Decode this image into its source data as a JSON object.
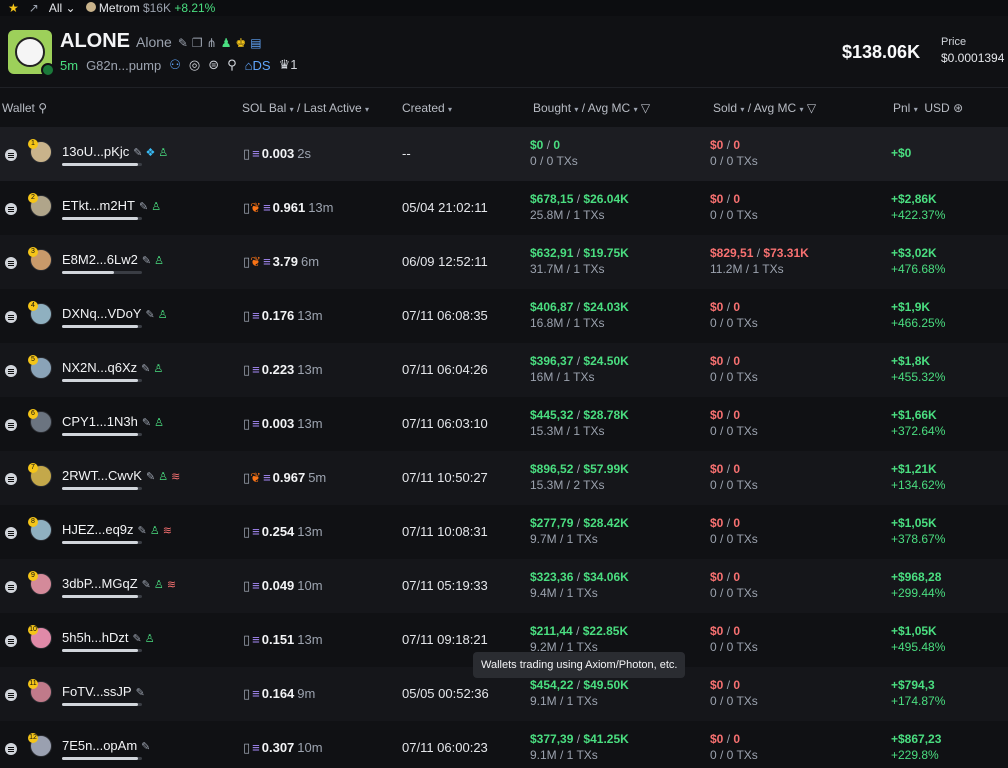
{
  "topbar": {
    "filter": "All",
    "token_name": "Metrom",
    "token_mcap": "$16K",
    "token_change": "+8.21%"
  },
  "token": {
    "name": "ALONE",
    "subname": "Alone",
    "age": "5m",
    "address": "G82n...pump",
    "ds_label": "DS",
    "holders_count": "1",
    "market_cap": "$138.06K",
    "price_label": "Price",
    "price": "$0.0001394"
  },
  "columns": {
    "wallet": "Wallet",
    "sol_bal": "SOL Bal",
    "last_active": "/ Last Active",
    "created": "Created",
    "bought": "Bought",
    "avg_mc_b": "/ Avg MC",
    "sold": "Sold",
    "avg_mc_s": "/ Avg MC",
    "pnl": "Pnl",
    "usd": "USD"
  },
  "tooltip": "Wallets trading using Axiom/Photon, etc.",
  "rows": [
    {
      "rank": "1",
      "wallet": "13oU...pKjc",
      "sol": "0.003",
      "age": "2s",
      "created": "--",
      "bought": "$0",
      "bought_mc": "0",
      "bought_sub": "0 / 0 TXs",
      "sold": "$0",
      "sold_mc": "0",
      "sold_sub": "0 / 0 TXs",
      "pnl": "+$0",
      "pct": "",
      "bar": 0.95
    },
    {
      "rank": "2",
      "wallet": "ETkt...m2HT",
      "sol": "0.961",
      "age": "13m",
      "created": "05/04 21:02:11",
      "bought": "$678,15",
      "bought_mc": "$26.04K",
      "bought_sub": "25.8M / 1 TXs",
      "sold": "$0",
      "sold_mc": "0",
      "sold_sub": "0 / 0 TXs",
      "pnl": "+$2,86K",
      "pct": "+422.37%",
      "bar": 0.95
    },
    {
      "rank": "3",
      "wallet": "E8M2...6Lw2",
      "sol": "3.79",
      "age": "6m",
      "created": "06/09 12:52:11",
      "bought": "$632,91",
      "bought_mc": "$19.75K",
      "bought_sub": "31.7M / 1 TXs",
      "sold": "$829,51",
      "sold_mc": "$73.31K",
      "sold_sub": "11.2M / 1 TXs",
      "pnl": "+$3,02K",
      "pct": "+476.68%",
      "bar": 0.65
    },
    {
      "rank": "4",
      "wallet": "DXNq...VDoY",
      "sol": "0.176",
      "age": "13m",
      "created": "07/11 06:08:35",
      "bought": "$406,87",
      "bought_mc": "$24.03K",
      "bought_sub": "16.8M / 1 TXs",
      "sold": "$0",
      "sold_mc": "0",
      "sold_sub": "0 / 0 TXs",
      "pnl": "+$1,9K",
      "pct": "+466.25%",
      "bar": 0.95
    },
    {
      "rank": "5",
      "wallet": "NX2N...q6Xz",
      "sol": "0.223",
      "age": "13m",
      "created": "07/11 06:04:26",
      "bought": "$396,37",
      "bought_mc": "$24.50K",
      "bought_sub": "16M / 1 TXs",
      "sold": "$0",
      "sold_mc": "0",
      "sold_sub": "0 / 0 TXs",
      "pnl": "+$1,8K",
      "pct": "+455.32%",
      "bar": 0.95
    },
    {
      "rank": "6",
      "wallet": "CPY1...1N3h",
      "sol": "0.003",
      "age": "13m",
      "created": "07/11 06:03:10",
      "bought": "$445,32",
      "bought_mc": "$28.78K",
      "bought_sub": "15.3M / 1 TXs",
      "sold": "$0",
      "sold_mc": "0",
      "sold_sub": "0 / 0 TXs",
      "pnl": "+$1,66K",
      "pct": "+372.64%",
      "bar": 0.95
    },
    {
      "rank": "7",
      "wallet": "2RWT...CwvK",
      "sol": "0.967",
      "age": "5m",
      "created": "07/11 10:50:27",
      "bought": "$896,52",
      "bought_mc": "$57.99K",
      "bought_sub": "15.3M / 2 TXs",
      "sold": "$0",
      "sold_mc": "0",
      "sold_sub": "0 / 0 TXs",
      "pnl": "+$1,21K",
      "pct": "+134.62%",
      "bar": 0.95
    },
    {
      "rank": "8",
      "wallet": "HJEZ...eq9z",
      "sol": "0.254",
      "age": "13m",
      "created": "07/11 10:08:31",
      "bought": "$277,79",
      "bought_mc": "$28.42K",
      "bought_sub": "9.7M / 1 TXs",
      "sold": "$0",
      "sold_mc": "0",
      "sold_sub": "0 / 0 TXs",
      "pnl": "+$1,05K",
      "pct": "+378.67%",
      "bar": 0.95
    },
    {
      "rank": "9",
      "wallet": "3dbP...MGqZ",
      "sol": "0.049",
      "age": "10m",
      "created": "07/11 05:19:33",
      "bought": "$323,36",
      "bought_mc": "$34.06K",
      "bought_sub": "9.4M / 1 TXs",
      "sold": "$0",
      "sold_mc": "0",
      "sold_sub": "0 / 0 TXs",
      "pnl": "+$968,28",
      "pct": "+299.44%",
      "bar": 0.95
    },
    {
      "rank": "10",
      "wallet": "5h5h...hDzt",
      "sol": "0.151",
      "age": "13m",
      "created": "07/11 09:18:21",
      "bought": "$211,44",
      "bought_mc": "$22.85K",
      "bought_sub": "9.2M / 1 TXs",
      "sold": "$0",
      "sold_mc": "0",
      "sold_sub": "0 / 0 TXs",
      "pnl": "+$1,05K",
      "pct": "+495.48%",
      "bar": 0.95
    },
    {
      "rank": "11",
      "wallet": "FoTV...ssJP",
      "sol": "0.164",
      "age": "9m",
      "created": "05/05 00:52:36",
      "bought": "$454,22",
      "bought_mc": "$49.50K",
      "bought_sub": "9.1M / 1 TXs",
      "sold": "$0",
      "sold_mc": "0",
      "sold_sub": "0 / 0 TXs",
      "pnl": "+$794,3",
      "pct": "+174.87%",
      "bar": 0.95
    },
    {
      "rank": "12",
      "wallet": "7E5n...opAm",
      "sol": "0.307",
      "age": "10m",
      "created": "07/11 06:00:23",
      "bought": "$377,39",
      "bought_mc": "$41.25K",
      "bought_sub": "9.1M / 1 TXs",
      "sold": "$0",
      "sold_mc": "0",
      "sold_sub": "0 / 0 TXs",
      "pnl": "+$867,23",
      "pct": "+229.8%",
      "bar": 0.95
    }
  ]
}
